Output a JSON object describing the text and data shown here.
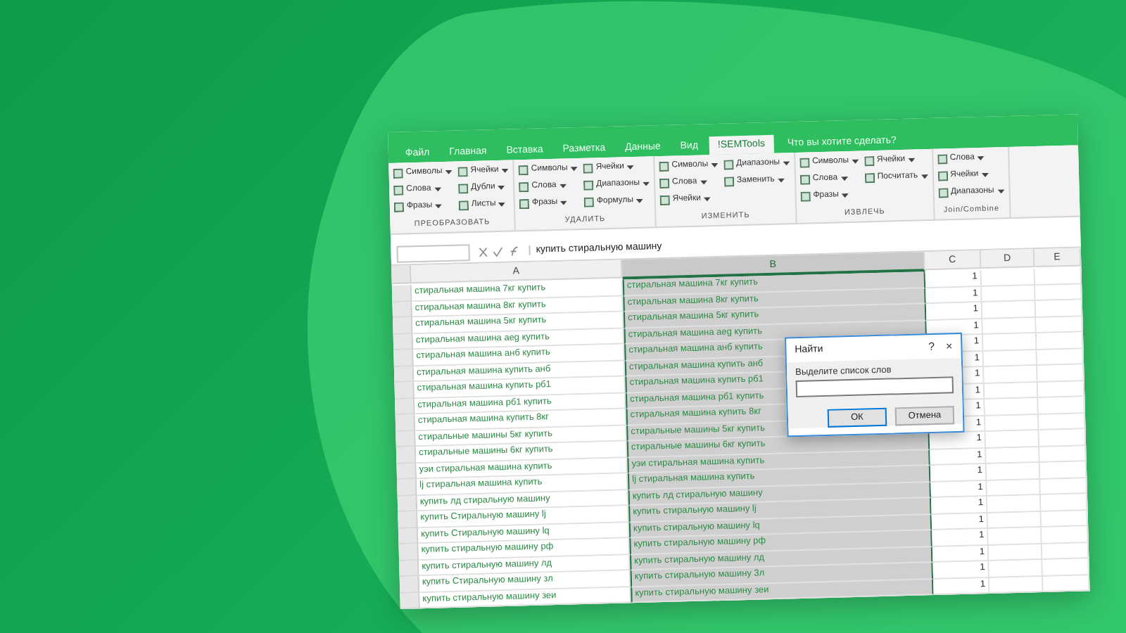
{
  "ribbon": {
    "tabs": [
      {
        "label": "Файл",
        "selected": false
      },
      {
        "label": "Главная",
        "selected": false
      },
      {
        "label": "Вставка",
        "selected": false
      },
      {
        "label": "Разметка",
        "selected": false
      },
      {
        "label": "Данные",
        "selected": false
      },
      {
        "label": "Вид",
        "selected": false
      },
      {
        "label": "!SEMTools",
        "selected": true
      }
    ],
    "tell_me": "Что вы хотите сделать?",
    "groups": [
      {
        "label": "ПРЕОБРАЗОВАТЬ",
        "columns": [
          [
            "Символы",
            "Слова",
            "Фразы"
          ],
          [
            "Ячейки",
            "Дубли",
            "Листы"
          ]
        ]
      },
      {
        "label": "УДАЛИТЬ",
        "columns": [
          [
            "Символы",
            "Слова",
            "Фразы"
          ],
          [
            "Ячейки",
            "Диапазоны",
            "Формулы"
          ]
        ]
      },
      {
        "label": "ИЗМЕНИТЬ",
        "columns": [
          [
            "Символы",
            "Слова",
            "Ячейки"
          ],
          [
            "Диапазоны",
            "Заменить"
          ]
        ]
      },
      {
        "label": "ИЗВЛЕЧЬ",
        "columns": [
          [
            "Символы",
            "Слова",
            "Фразы"
          ],
          [
            "Ячейки",
            "Посчитать"
          ]
        ]
      },
      {
        "label": "Join/Combine",
        "columns": [
          [
            "Слова",
            "Ячейки",
            "Диапазоны"
          ]
        ]
      }
    ]
  },
  "formula_bar": {
    "value": "купить стиральную машину"
  },
  "sheet": {
    "columns": [
      {
        "label": "A",
        "selected": false
      },
      {
        "label": "B",
        "selected": true
      },
      {
        "label": "C",
        "selected": false
      },
      {
        "label": "D",
        "selected": false
      },
      {
        "label": "E",
        "selected": false
      }
    ],
    "rows": [
      {
        "a": "стиральная машина 7кг купить",
        "b": "стиральная машина 7кг купить",
        "c": "1"
      },
      {
        "a": "стиральная машина 8кг купить",
        "b": "стиральная машина 8кг купить",
        "c": "1"
      },
      {
        "a": "стиральная машина 5кг купить",
        "b": "стиральная машина 5кг купить",
        "c": "1"
      },
      {
        "a": "стиральная машина аеg купить",
        "b": "стиральная машина аеg купить",
        "c": "1"
      },
      {
        "a": "стиральная машина анб купить",
        "b": "стиральная машина анб купить",
        "c": "1"
      },
      {
        "a": "стиральная машина купить анб",
        "b": "стиральная машина купить анб",
        "c": "1"
      },
      {
        "a": "стиральная машина купить рб1",
        "b": "стиральная машина купить рб1",
        "c": "1"
      },
      {
        "a": "стиральная машина рб1 купить",
        "b": "стиральная машина рб1 купить",
        "c": "1"
      },
      {
        "a": "стиральная машина купить 8кг",
        "b": "стиральная машина купить 8кг",
        "c": "1"
      },
      {
        "a": "стиральные машины 5кг купить",
        "b": "стиральные машины 5кг купить",
        "c": "1"
      },
      {
        "a": "стиральные машины 6кг купить",
        "b": "стиральные машины 6кг купить",
        "c": "1"
      },
      {
        "a": "уэи стиральная машина купить",
        "b": "уэи стиральная машина купить",
        "c": "1"
      },
      {
        "a": "lj стиральная машина купить",
        "b": "lj стиральная машина купить",
        "c": "1"
      },
      {
        "a": "купить лд стиральную машину",
        "b": "купить лд стиральную машину",
        "c": "1"
      },
      {
        "a": "купить Стиральную машину lj",
        "b": "купить стиральную машину lj",
        "c": "1"
      },
      {
        "a": "купить Стиральную машину lq",
        "b": "купить стиральную машину lq",
        "c": "1"
      },
      {
        "a": "купить стиральную машину рф",
        "b": "купить стиральную машину рф",
        "c": "1"
      },
      {
        "a": "купить стиральную машину лд",
        "b": "купить стиральную машину лд",
        "c": "1"
      },
      {
        "a": "купить Стиральную машину зл",
        "b": "купить стиральную машину 3л",
        "c": "1"
      },
      {
        "a": "купить стиральную машину зеи",
        "b": "купить стиральную машину зеи",
        "c": "1"
      }
    ]
  },
  "dialog": {
    "title": "Найти",
    "help": "?",
    "close": "×",
    "prompt": "Выделите список слов",
    "buttons": [
      {
        "label": "ОК",
        "default": true
      },
      {
        "label": "Отмена",
        "default": false
      }
    ]
  }
}
